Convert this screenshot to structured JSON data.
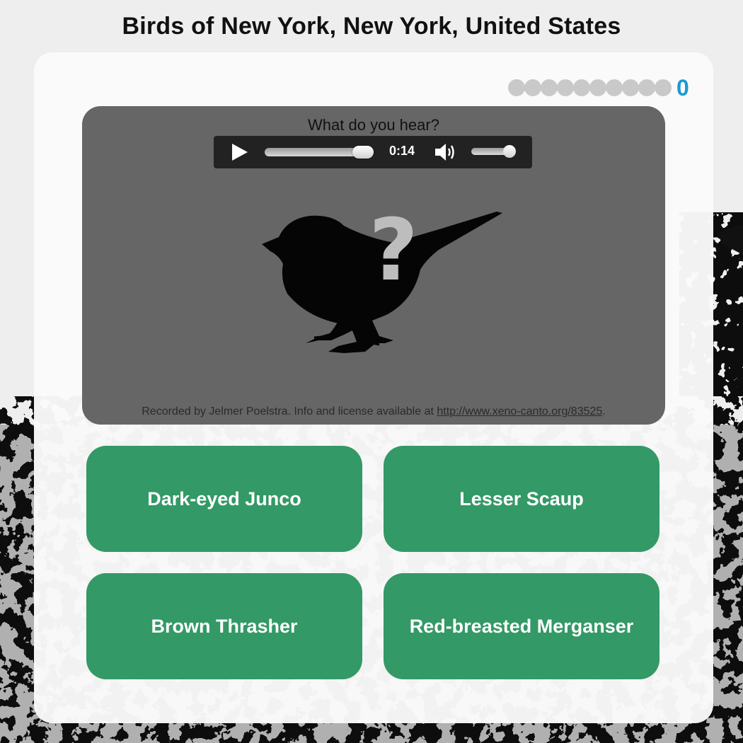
{
  "page": {
    "title": "Birds of New York, New York, United States"
  },
  "progress": {
    "completed": 0,
    "total": 10,
    "score": "0",
    "dot_color": "#c9c9c9",
    "score_color": "#1a9bd1"
  },
  "quiz": {
    "prompt": "What do you hear?",
    "player": {
      "time": "0:14",
      "seek_fraction": 1.0,
      "volume_fraction": 0.9,
      "play_icon": "play-icon",
      "volume_icon": "speaker-volume-icon"
    },
    "image_icon": "bird-silhouette-question-icon",
    "credit": {
      "prefix": "Recorded by Jelmer Poelstra. Info and license available at",
      "link_text": "http://www.xeno-canto.org/83525",
      "suffix": "."
    }
  },
  "answers": [
    {
      "label": "Dark-eyed Junco"
    },
    {
      "label": "Lesser Scaup"
    },
    {
      "label": "Brown Thrasher"
    },
    {
      "label": "Red-breasted Merganser"
    }
  ],
  "colors": {
    "answer_bg": "#339966",
    "panel_bg": "#666666",
    "card_bg": "#fafafa"
  }
}
